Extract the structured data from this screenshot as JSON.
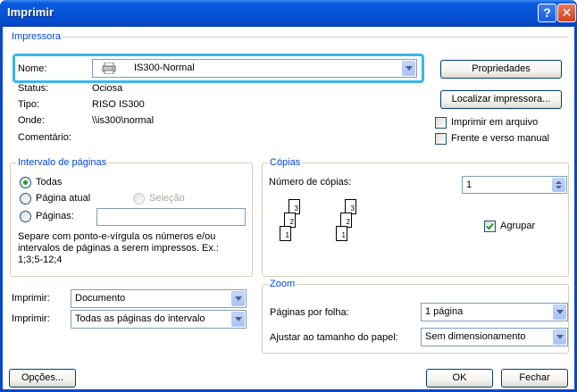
{
  "window": {
    "title": "Imprimir",
    "help_glyph": "?",
    "close_glyph": "✕"
  },
  "printer": {
    "group_title": "Impressora",
    "name_label": "Nome:",
    "name_value": "IS300-Normal",
    "status_label": "Status:",
    "status_value": "Ociosa",
    "type_label": "Tipo:",
    "type_value": "RISO IS300",
    "where_label": "Onde:",
    "where_value": "\\\\is300\\normal",
    "comment_label": "Comentário:",
    "properties_button": "Propriedades",
    "find_printer_button": "Localizar impressora...",
    "print_to_file_label": "Imprimir em arquivo",
    "manual_duplex_label": "Frente e verso manual"
  },
  "page_range": {
    "group_title": "Intervalo de páginas",
    "all_label": "Todas",
    "current_page_label": "Página atual",
    "selection_label": "Seleção",
    "pages_label": "Páginas:",
    "pages_value": "",
    "hint_line1": "Separe com ponto-e-vírgula os números e/ou",
    "hint_line2": "intervalos de páginas a serem impressos.  Ex.:",
    "hint_line3": "1;3;5-12;4"
  },
  "copies": {
    "group_title": "Cópias",
    "count_label": "Número de cópias:",
    "count_value": "1",
    "collate_label": "Agrupar",
    "collate_checked": true,
    "page_numbers": [
      "1",
      "2",
      "3"
    ]
  },
  "print_what": {
    "label": "Imprimir:",
    "value": "Documento"
  },
  "print_range": {
    "label": "Imprimir:",
    "value": "Todas as páginas do intervalo"
  },
  "zoom": {
    "group_title": "Zoom",
    "pages_per_sheet_label": "Páginas por folha:",
    "pages_per_sheet_value": "1 página",
    "scale_label": "Ajustar ao tamanho do papel:",
    "scale_value": "Sem dimensionamento"
  },
  "footer": {
    "options_button": "Opções...",
    "ok_button": "OK",
    "close_button": "Fechar"
  },
  "colors": {
    "titlebar": "#0654d8",
    "group_title": "#0046d5",
    "highlight_border": "#38b7ea"
  }
}
